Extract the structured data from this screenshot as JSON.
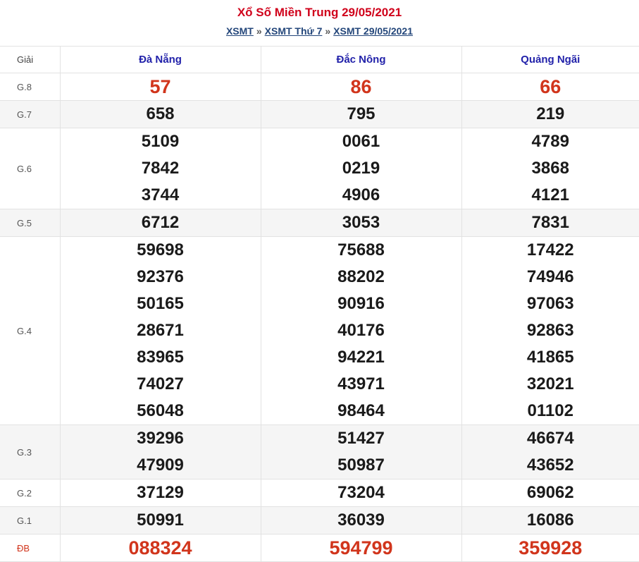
{
  "header": {
    "title": "Xổ Số Miền Trung 29/05/2021",
    "breadcrumb": [
      "XSMT",
      "XSMT Thứ 7",
      "XSMT 29/05/2021"
    ],
    "separator": "»"
  },
  "table": {
    "label_header": "Giải",
    "provinces": [
      "Đà Nẵng",
      "Đắc Nông",
      "Quảng Ngãi"
    ],
    "prizes": [
      {
        "label": "G.8",
        "highlight": true,
        "values": [
          [
            "57"
          ],
          [
            "86"
          ],
          [
            "66"
          ]
        ]
      },
      {
        "label": "G.7",
        "highlight": false,
        "values": [
          [
            "658"
          ],
          [
            "795"
          ],
          [
            "219"
          ]
        ]
      },
      {
        "label": "G.6",
        "highlight": false,
        "values": [
          [
            "5109",
            "7842",
            "3744"
          ],
          [
            "0061",
            "0219",
            "4906"
          ],
          [
            "4789",
            "3868",
            "4121"
          ]
        ]
      },
      {
        "label": "G.5",
        "highlight": false,
        "values": [
          [
            "6712"
          ],
          [
            "3053"
          ],
          [
            "7831"
          ]
        ]
      },
      {
        "label": "G.4",
        "highlight": false,
        "values": [
          [
            "59698",
            "92376",
            "50165",
            "28671",
            "83965",
            "74027",
            "56048"
          ],
          [
            "75688",
            "88202",
            "90916",
            "40176",
            "94221",
            "43971",
            "98464"
          ],
          [
            "17422",
            "74946",
            "97063",
            "92863",
            "41865",
            "32021",
            "01102"
          ]
        ]
      },
      {
        "label": "G.3",
        "highlight": false,
        "values": [
          [
            "39296",
            "47909"
          ],
          [
            "51427",
            "50987"
          ],
          [
            "46674",
            "43652"
          ]
        ]
      },
      {
        "label": "G.2",
        "highlight": false,
        "values": [
          [
            "37129"
          ],
          [
            "73204"
          ],
          [
            "69062"
          ]
        ]
      },
      {
        "label": "G.1",
        "highlight": false,
        "values": [
          [
            "50991"
          ],
          [
            "36039"
          ],
          [
            "16086"
          ]
        ]
      },
      {
        "label": "ĐB",
        "highlight": true,
        "values": [
          [
            "088324"
          ],
          [
            "594799"
          ],
          [
            "359928"
          ]
        ]
      }
    ]
  },
  "colors": {
    "title": "#d0021b",
    "highlight_number": "#d1351c",
    "province_header": "#2222aa",
    "link": "#23467a"
  }
}
